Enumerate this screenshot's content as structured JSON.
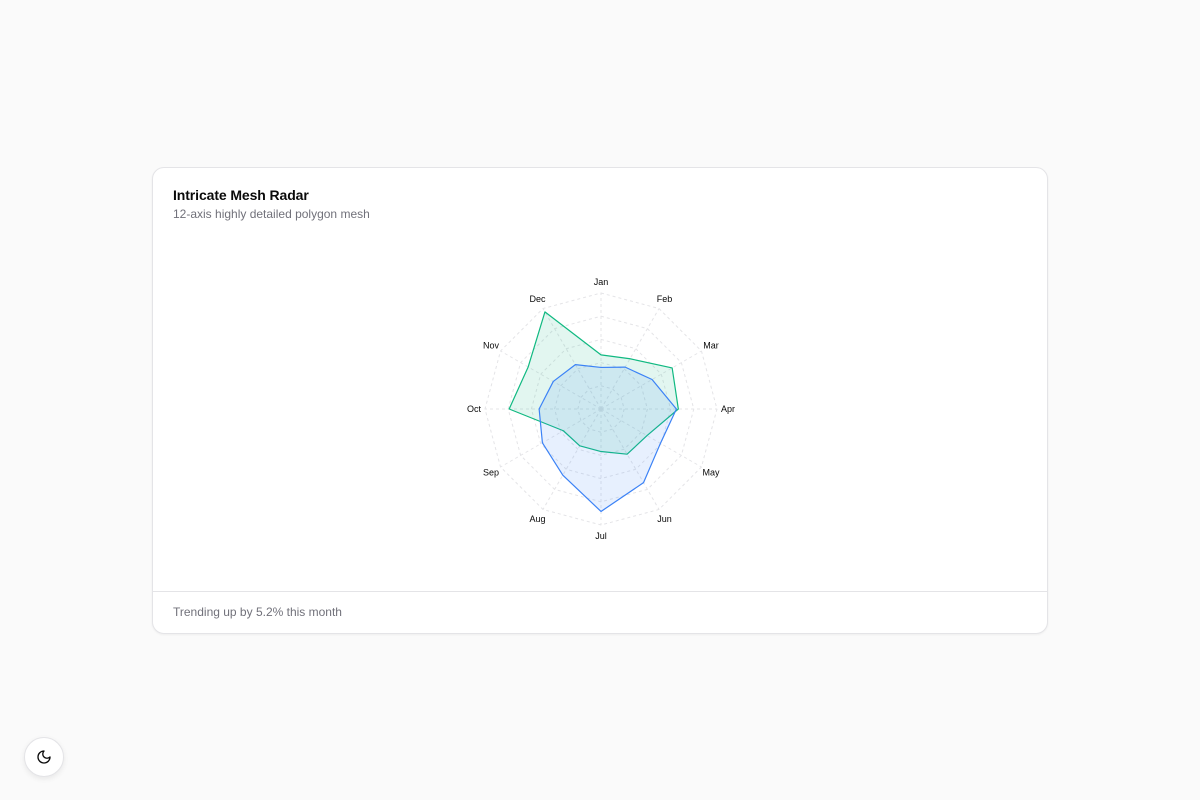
{
  "card": {
    "title": "Intricate Mesh Radar",
    "description": "12-axis highly detailed polygon mesh",
    "footer": "Trending up by 5.2% this month"
  },
  "theme_toggle": {
    "icon": "moon-icon"
  },
  "chart_data": {
    "type": "radar",
    "categories": [
      "Jan",
      "Feb",
      "Mar",
      "Apr",
      "May",
      "Jun",
      "Jul",
      "Aug",
      "Sep",
      "Oct",
      "Nov",
      "Dec"
    ],
    "series": [
      {
        "values": [
          56,
          60,
          85,
          80,
          55,
          54,
          44,
          44,
          45,
          95,
          87,
          116
        ],
        "color": "#10b981"
      },
      {
        "values": [
          43,
          50,
          61,
          78,
          71,
          88,
          106,
          79,
          70,
          64,
          57,
          53
        ],
        "color": "#3b82f6"
      }
    ],
    "rlim": [
      0,
      120
    ],
    "grid": true,
    "legend": false
  }
}
